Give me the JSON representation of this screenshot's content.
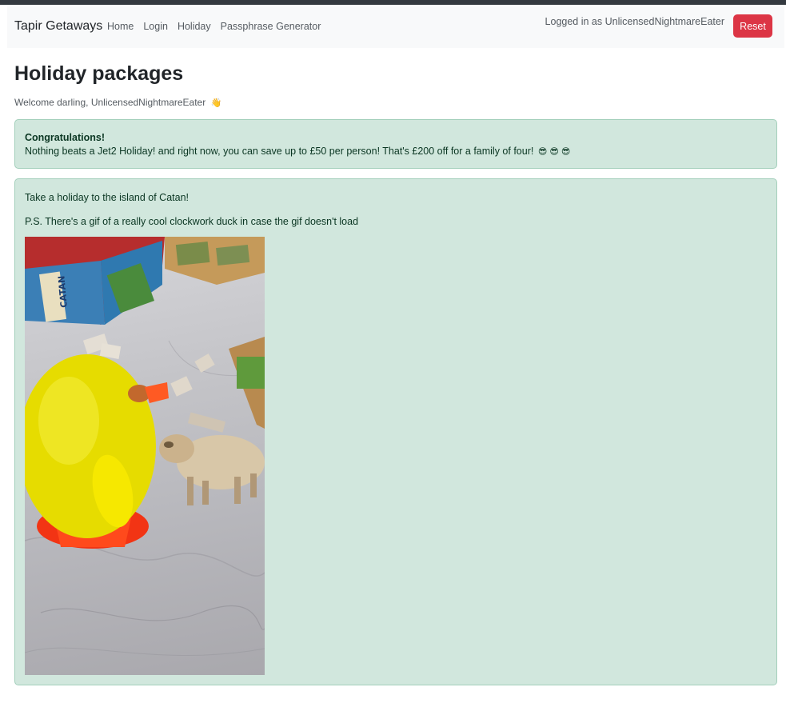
{
  "navbar": {
    "brand": "Tapir Getaways",
    "links": [
      "Home",
      "Login",
      "Holiday",
      "Passphrase Generator"
    ],
    "logged_in_text": "Logged in as UnlicensedNightmareEater",
    "reset_label": "Reset"
  },
  "page": {
    "title": "Holiday packages",
    "welcome": "Welcome darling, UnlicensedNightmareEater",
    "welcome_emoji": "👋"
  },
  "promo_alert": {
    "heading": "Congratulations!",
    "body": "Nothing beats a Jet2 Holiday! and right now, you can save up to £50 per person! That's £200 off for a family of four!",
    "emojis": "😎 😎 😎"
  },
  "catan_alert": {
    "line1": "Take a holiday to the island of Catan!",
    "line2": "P.S. There's a gif of a really cool clockwork duck in case the gif doesn't load",
    "image_label": "CATAN"
  },
  "colors": {
    "success_bg": "#d1e7dd",
    "danger": "#dc3545",
    "navbar_bg": "#f8f9fa"
  }
}
